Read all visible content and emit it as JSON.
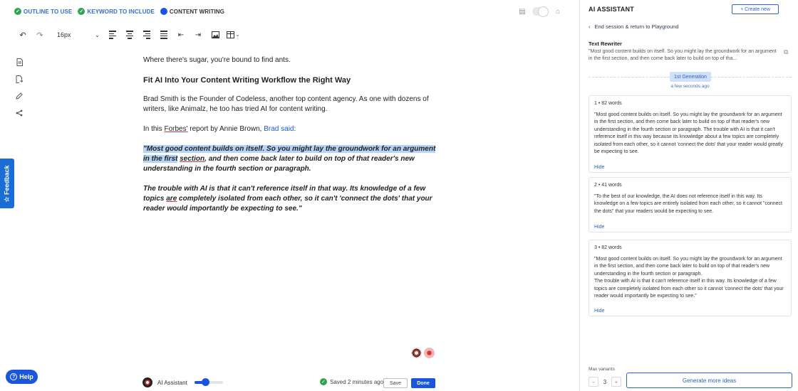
{
  "steps": [
    {
      "label": "OUTLINE TO USE",
      "status": "done"
    },
    {
      "label": "KEYWORD TO INCLUDE",
      "status": "done"
    },
    {
      "label": "CONTENT WRITING",
      "status": "current"
    }
  ],
  "toolbar": {
    "font_size": "16px"
  },
  "feedback": {
    "label": "Feedback"
  },
  "document": {
    "intro": "Where there's sugar, you're bound to find ants.",
    "heading": "Fit AI Into Your Content Writing Workflow the Right Way",
    "para1": "Brad Smith is the Founder of Codeless, another top content agency. As one with dozens of writers, like Animalz, he too has tried AI for content writing.",
    "para2_pre": "In this ",
    "para2_forbes": "Forbes'",
    "para2_mid": " report by Annie Brown, ",
    "para2_link": "Brad said",
    "para2_post": ":",
    "quote1_hl": "\"Most good content builds on itself. So you might lay the groundwork for an argument in the first",
    "quote1_ul": "section",
    "quote1_rest": ", and then come back later to build on top of that reader's new understanding in the fourth section or paragraph.",
    "quote2_pre": "The trouble with AI is that it can't reference itself in that way. Its knowledge of a few topics ",
    "quote2_are": "are",
    "quote2_post": " completely isolated from each other, so it can't 'connect the dots' that your reader would importantly be expecting to see.\""
  },
  "bottom": {
    "help_label": "Help",
    "assistant_label": "AI Assistant",
    "saved_text": "Saved 2 minutes ago",
    "save_label": "Save",
    "done_label": "Done"
  },
  "panel": {
    "title": "AI ASSISTANT",
    "create_new": "+ Create new",
    "back_label": "End session & return to Playground",
    "tool_name": "Text Rewriter",
    "preview": "\"Most good content builds on itself. So you might lay the groundwork for an argument in the first section, and then come back later to build on top of tha...",
    "generation_badge": "1st Generation",
    "generation_time": "a few seconds ago",
    "results": [
      {
        "index": "1",
        "words": "82 words",
        "text": "\"Most good content builds on itself. So you might lay the groundwork for an argument in the first section, and then come back later to build on top of that reader's new understanding in the fourth section or paragraph. The trouble with AI is that it can't reference itself in this way because its knowledge about a few topics are completely isolated from each other, so it cannot 'connect the dots' that your reader would greatly be expecting to see.",
        "hide": "Hide"
      },
      {
        "index": "2",
        "words": "41 words",
        "text": "\"To the best of our knowledge, the AI does not reference itself in this way. Its knowledge on a few topics are entirely isolated from each other, so it cannot \"connect the dots\" that your readers would be expecting to see.",
        "hide": "Hide"
      },
      {
        "index": "3",
        "words": "82 words",
        "text": "\"Most good content builds on itself. So you might lay the groundwork for an argument in the first section, and then come back later to build on top of that reader's new understanding in the fourth section or paragraph.\nThe trouble with AI is that it can't reference itself in this way. Its knowledge of a few topics are completely isolated from each other so it cannot 'connect the dots' that your reader would importantly be expecting to see.\"",
        "hide": "Hide"
      }
    ],
    "max_variants_label": "Max variants",
    "max_variants_value": "3",
    "generate_more": "Generate more ideas"
  },
  "colors": {
    "accent": "#1a56db",
    "success": "#2ea44f",
    "highlight": "#b6d4f5"
  }
}
